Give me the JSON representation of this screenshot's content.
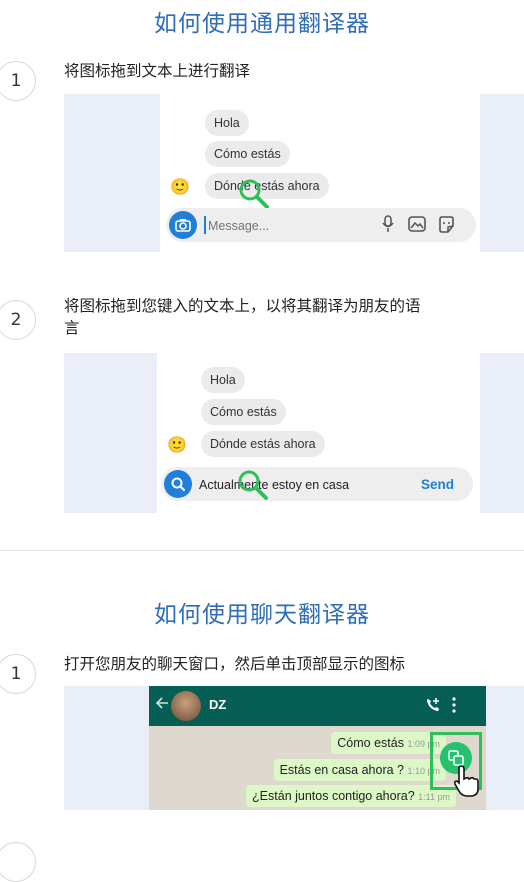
{
  "section1": {
    "title": "如何使用通用翻译器",
    "steps": [
      {
        "number": "1",
        "text": "将图标拖到文本上进行翻译",
        "bubbles": [
          "Hola",
          "Cómo estás",
          "Dónde estás ahora"
        ],
        "input_placeholder": "Message..."
      },
      {
        "number": "2",
        "text_line1": "将图标拖到您键入的文本上，以将其翻译为朋友的语",
        "text_line2": "言",
        "bubbles": [
          "Hola",
          "Cómo estás",
          "Dónde estás ahora"
        ],
        "input_value": "Actualmente estoy en casa",
        "send_label": "Send"
      }
    ]
  },
  "section2": {
    "title": "如何使用聊天翻译器",
    "steps": [
      {
        "number": "1",
        "text": "打开您朋友的聊天窗口，然后单击顶部显示的图标",
        "chat_name": "DZ",
        "messages": [
          {
            "text": "Cómo estás",
            "time": "1:09 pm"
          },
          {
            "text": "Estás en casa ahora ?",
            "time": "1:10 pm"
          },
          {
            "text": "¿Están juntos contigo ahora?",
            "time": "1:11 pm"
          }
        ]
      }
    ]
  },
  "icons": {
    "camera": "camera-icon",
    "mic": "mic-icon",
    "gallery": "gallery-icon",
    "sticker": "sticker-icon",
    "search": "search-icon",
    "magnifier": "magnifier-icon",
    "translate": "translate-icon",
    "hand": "hand-pointer-icon"
  },
  "colors": {
    "title": "#2f6db8",
    "accent_blue": "#1f7fd9",
    "magnifier_green": "#2fbf5a",
    "wa_header": "#075e54",
    "wa_bubble": "#dcf8c6",
    "translate_button": "#25c16f"
  }
}
